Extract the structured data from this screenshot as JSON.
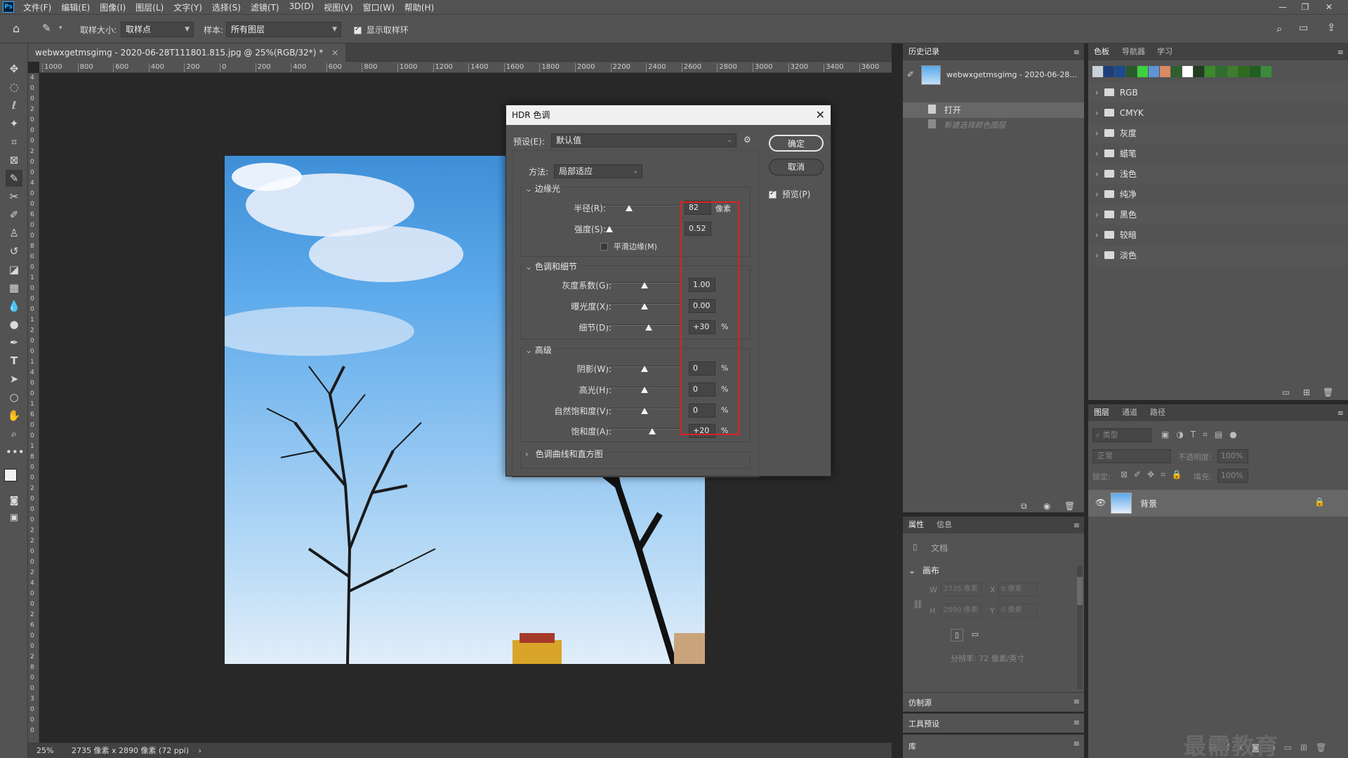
{
  "menubar": {
    "logo": "Ps",
    "items": [
      "文件(F)",
      "编辑(E)",
      "图像(I)",
      "图层(L)",
      "文字(Y)",
      "选择(S)",
      "滤镜(T)",
      "3D(D)",
      "视图(V)",
      "窗口(W)",
      "帮助(H)"
    ]
  },
  "options": {
    "sample_size_label": "取样大小:",
    "sample_size_value": "取样点",
    "sample_label": "样本:",
    "sample_value": "所有图层",
    "show_ring_label": "显示取样环"
  },
  "document": {
    "tab_title": "webwxgetmsgimg - 2020-06-28T111801.815.jpg @ 25%(RGB/32*) *",
    "tab_close": "×",
    "ruler_ticks": [
      "1000",
      "800",
      "600",
      "400",
      "200",
      "0",
      "200",
      "400",
      "600",
      "800",
      "1000",
      "1200",
      "1400",
      "1600",
      "1800",
      "2000",
      "2200",
      "2400",
      "2600",
      "2800",
      "3000",
      "3200",
      "3400",
      "3600"
    ],
    "ruler_v": [
      "4",
      "0",
      "0",
      "2",
      "0",
      "0",
      "0",
      "2",
      "0",
      "0",
      "4",
      "0",
      "0",
      "6",
      "0",
      "0",
      "8",
      "0",
      "0",
      "1",
      "0",
      "0",
      "0",
      "1",
      "2",
      "0",
      "0",
      "1",
      "4",
      "0",
      "0",
      "1",
      "6",
      "0",
      "0",
      "1",
      "8",
      "0",
      "0",
      "2",
      "0",
      "0",
      "0",
      "2",
      "2",
      "0",
      "0",
      "2",
      "4",
      "0",
      "0",
      "2",
      "6",
      "0",
      "0",
      "2",
      "8",
      "0",
      "0",
      "3",
      "0",
      "0",
      "0"
    ],
    "status_zoom": "25%",
    "status_info": "2735 像素 x 2890 像素 (72 ppi)",
    "status_arrow": "›"
  },
  "history": {
    "tab": "历史记录",
    "snapshot_name": "webwxgetmsgimg - 2020-06-28...",
    "items": [
      "打开",
      "新建选择颜色图层"
    ]
  },
  "swatches": {
    "tabs": [
      "色板",
      "导航器",
      "学习"
    ],
    "recent_colors": [
      "#c8d2dc",
      "#1f3f7a",
      "#1d4b8f",
      "#2a5a2a",
      "#3fd03f",
      "#5e94d6",
      "#d98a63",
      "#2f5f2f",
      "#ffffff",
      "#1e3e1e",
      "#3a8a2a",
      "#2e6e2e",
      "#3d7d2d",
      "#2c6c1c",
      "#1f5f1f",
      "#3b8b3b"
    ],
    "groups": [
      "RGB",
      "CMYK",
      "灰度",
      "蜡笔",
      "浅色",
      "纯净",
      "黑色",
      "较暗",
      "淡色"
    ]
  },
  "layers": {
    "tabs": [
      "图层",
      "通道",
      "路径"
    ],
    "filter_placeholder": "类型",
    "blend_mode": "正常",
    "opacity_label": "不透明度:",
    "opacity_value": "100%",
    "lock_label": "锁定:",
    "fill_label": "填充:",
    "fill_value": "100%",
    "layer_name": "背景"
  },
  "properties": {
    "tabs": [
      "属性",
      "信息"
    ],
    "doc_label": "文档",
    "canvas_section": "画布",
    "w_label": "W",
    "w_value": "2735 像素",
    "x_label": "X",
    "x_value": "0 像素",
    "h_label": "H",
    "h_value": "2890 像素",
    "y_label": "Y",
    "y_value": "0 像素",
    "resolution": "分辨率: 72 像素/英寸"
  },
  "collapsed_panels": [
    "仿制源",
    "工具预设",
    "库"
  ],
  "watermark": "最需教育",
  "hdr_dialog": {
    "title": "HDR 色调",
    "close": "✕",
    "preset_label": "预设(E):",
    "preset_value": "默认值",
    "ok": "确定",
    "cancel": "取消",
    "preview_label": "预览(P)",
    "method_label": "方法:",
    "method_value": "局部适应",
    "edge_glow": {
      "title": "边缘光",
      "radius_label": "半径(R):",
      "radius_value": "82",
      "radius_unit": "像素",
      "radius_pos": 0.35,
      "strength_label": "强度(S):",
      "strength_value": "0.52",
      "strength_pos": 0.1,
      "smooth_label": "平滑边缘(M)"
    },
    "tone_detail": {
      "title": "色调和细节",
      "gamma_label": "灰度系数(G):",
      "gamma_value": "1.00",
      "gamma_pos": 0.5,
      "exposure_label": "曝光度(X):",
      "exposure_value": "0.00",
      "exposure_pos": 0.5,
      "detail_label": "细节(D):",
      "detail_value": "+30",
      "detail_unit": "%",
      "detail_pos": 0.55
    },
    "advanced": {
      "title": "高级",
      "shadow_label": "阴影(W):",
      "shadow_value": "0",
      "shadow_unit": "%",
      "shadow_pos": 0.5,
      "highlight_label": "高光(H):",
      "highlight_value": "0",
      "highlight_unit": "%",
      "highlight_pos": 0.5,
      "vibrance_label": "自然饱和度(V):",
      "vibrance_value": "0",
      "vibrance_unit": "%",
      "vibrance_pos": 0.5,
      "saturation_label": "饱和度(A):",
      "saturation_value": "+20",
      "saturation_unit": "%",
      "saturation_pos": 0.6
    },
    "curve_section": "色调曲线和直方图"
  }
}
